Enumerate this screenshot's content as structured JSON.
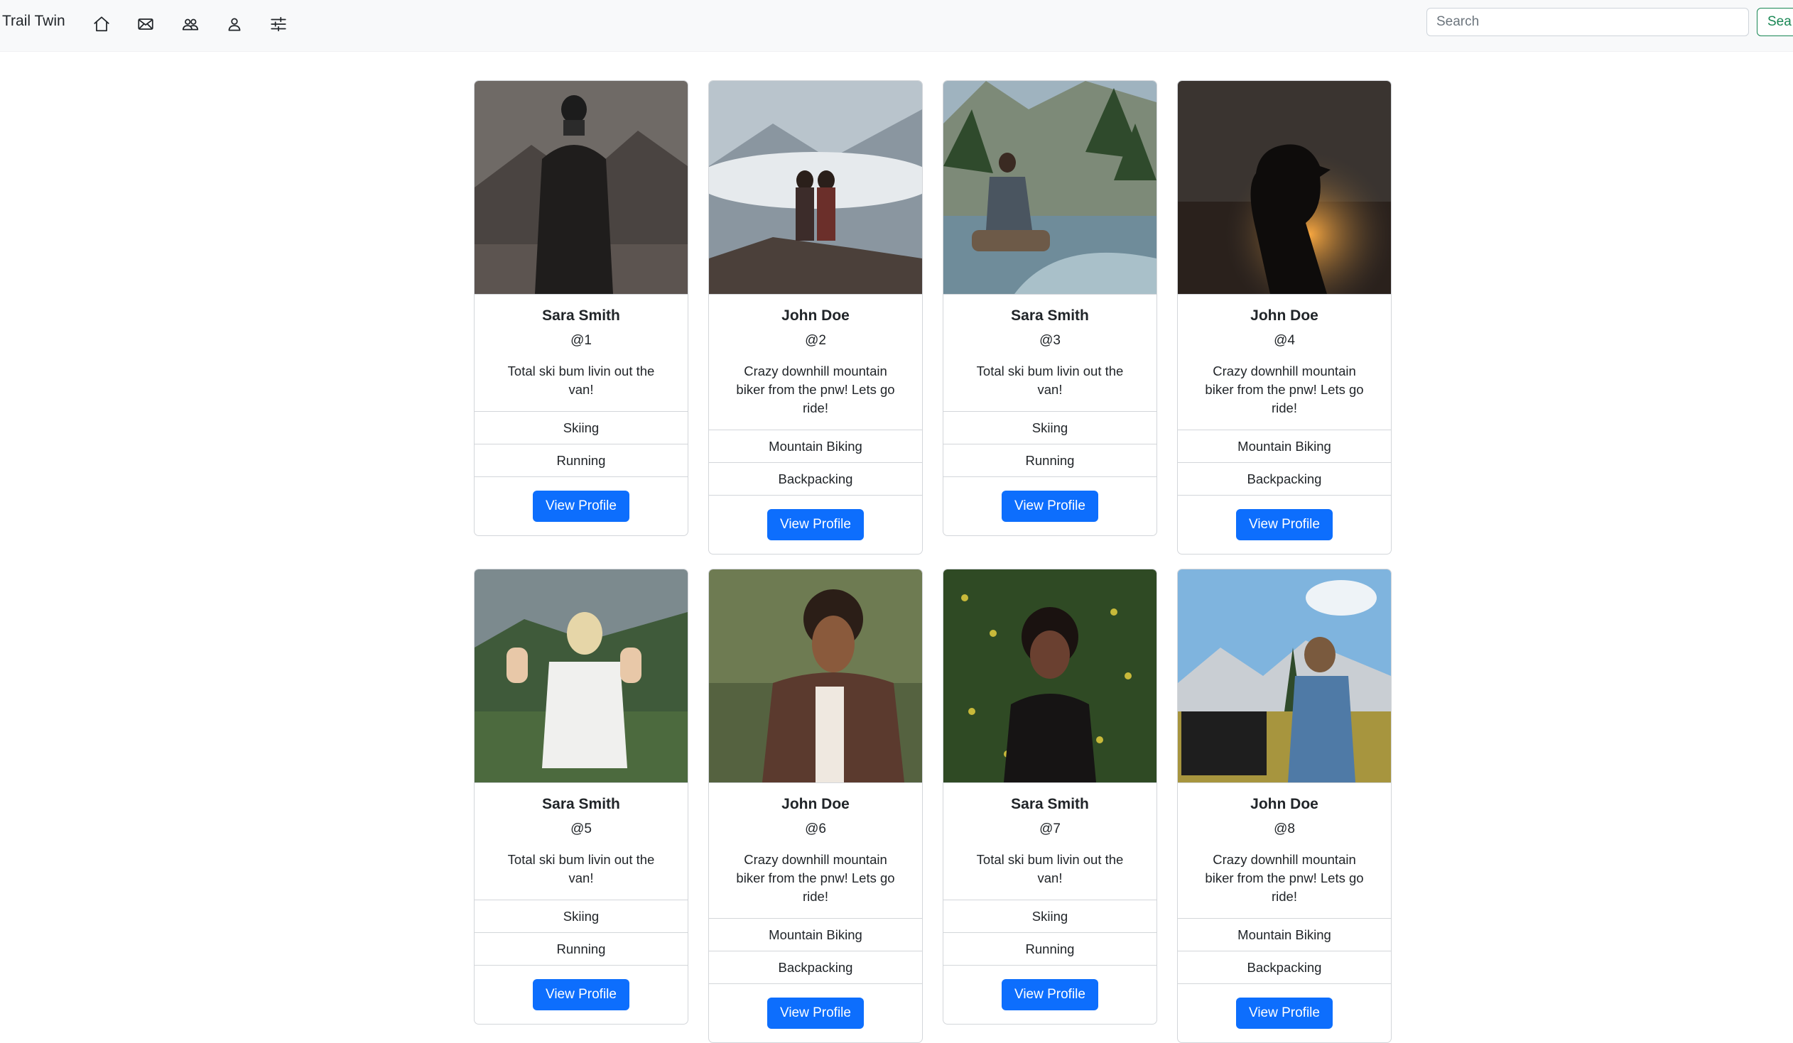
{
  "navbar": {
    "brand": "Trail Twin",
    "icons": [
      "home-icon",
      "envelope-icon",
      "people-icon",
      "person-icon",
      "sliders-icon"
    ],
    "search": {
      "placeholder": "Search",
      "button_label": "Sea"
    }
  },
  "colors": {
    "primary": "#0d6efd",
    "success": "#198754",
    "navbar_bg": "#f8f9fa",
    "border": "#d3d6da"
  },
  "profiles": [
    {
      "name": "Sara Smith",
      "handle": "@1",
      "bio": "Total ski bum livin out the van!",
      "activities": [
        "Skiing",
        "Running"
      ],
      "button": "View Profile"
    },
    {
      "name": "John Doe",
      "handle": "@2",
      "bio": "Crazy downhill mountain biker from the pnw! Lets go ride!",
      "activities": [
        "Mountain Biking",
        "Backpacking"
      ],
      "button": "View Profile"
    },
    {
      "name": "Sara Smith",
      "handle": "@3",
      "bio": "Total ski bum livin out the van!",
      "activities": [
        "Skiing",
        "Running"
      ],
      "button": "View Profile"
    },
    {
      "name": "John Doe",
      "handle": "@4",
      "bio": "Crazy downhill mountain biker from the pnw! Lets go ride!",
      "activities": [
        "Mountain Biking",
        "Backpacking"
      ],
      "button": "View Profile"
    },
    {
      "name": "Sara Smith",
      "handle": "@5",
      "bio": "Total ski bum livin out the van!",
      "activities": [
        "Skiing",
        "Running"
      ],
      "button": "View Profile"
    },
    {
      "name": "John Doe",
      "handle": "@6",
      "bio": "Crazy downhill mountain biker from the pnw! Lets go ride!",
      "activities": [
        "Mountain Biking",
        "Backpacking"
      ],
      "button": "View Profile"
    },
    {
      "name": "Sara Smith",
      "handle": "@7",
      "bio": "Total ski bum livin out the van!",
      "activities": [
        "Skiing",
        "Running"
      ],
      "button": "View Profile"
    },
    {
      "name": "John Doe",
      "handle": "@8",
      "bio": "Crazy downhill mountain biker from the pnw! Lets go ride!",
      "activities": [
        "Mountain Biking",
        "Backpacking"
      ],
      "button": "View Profile"
    }
  ]
}
